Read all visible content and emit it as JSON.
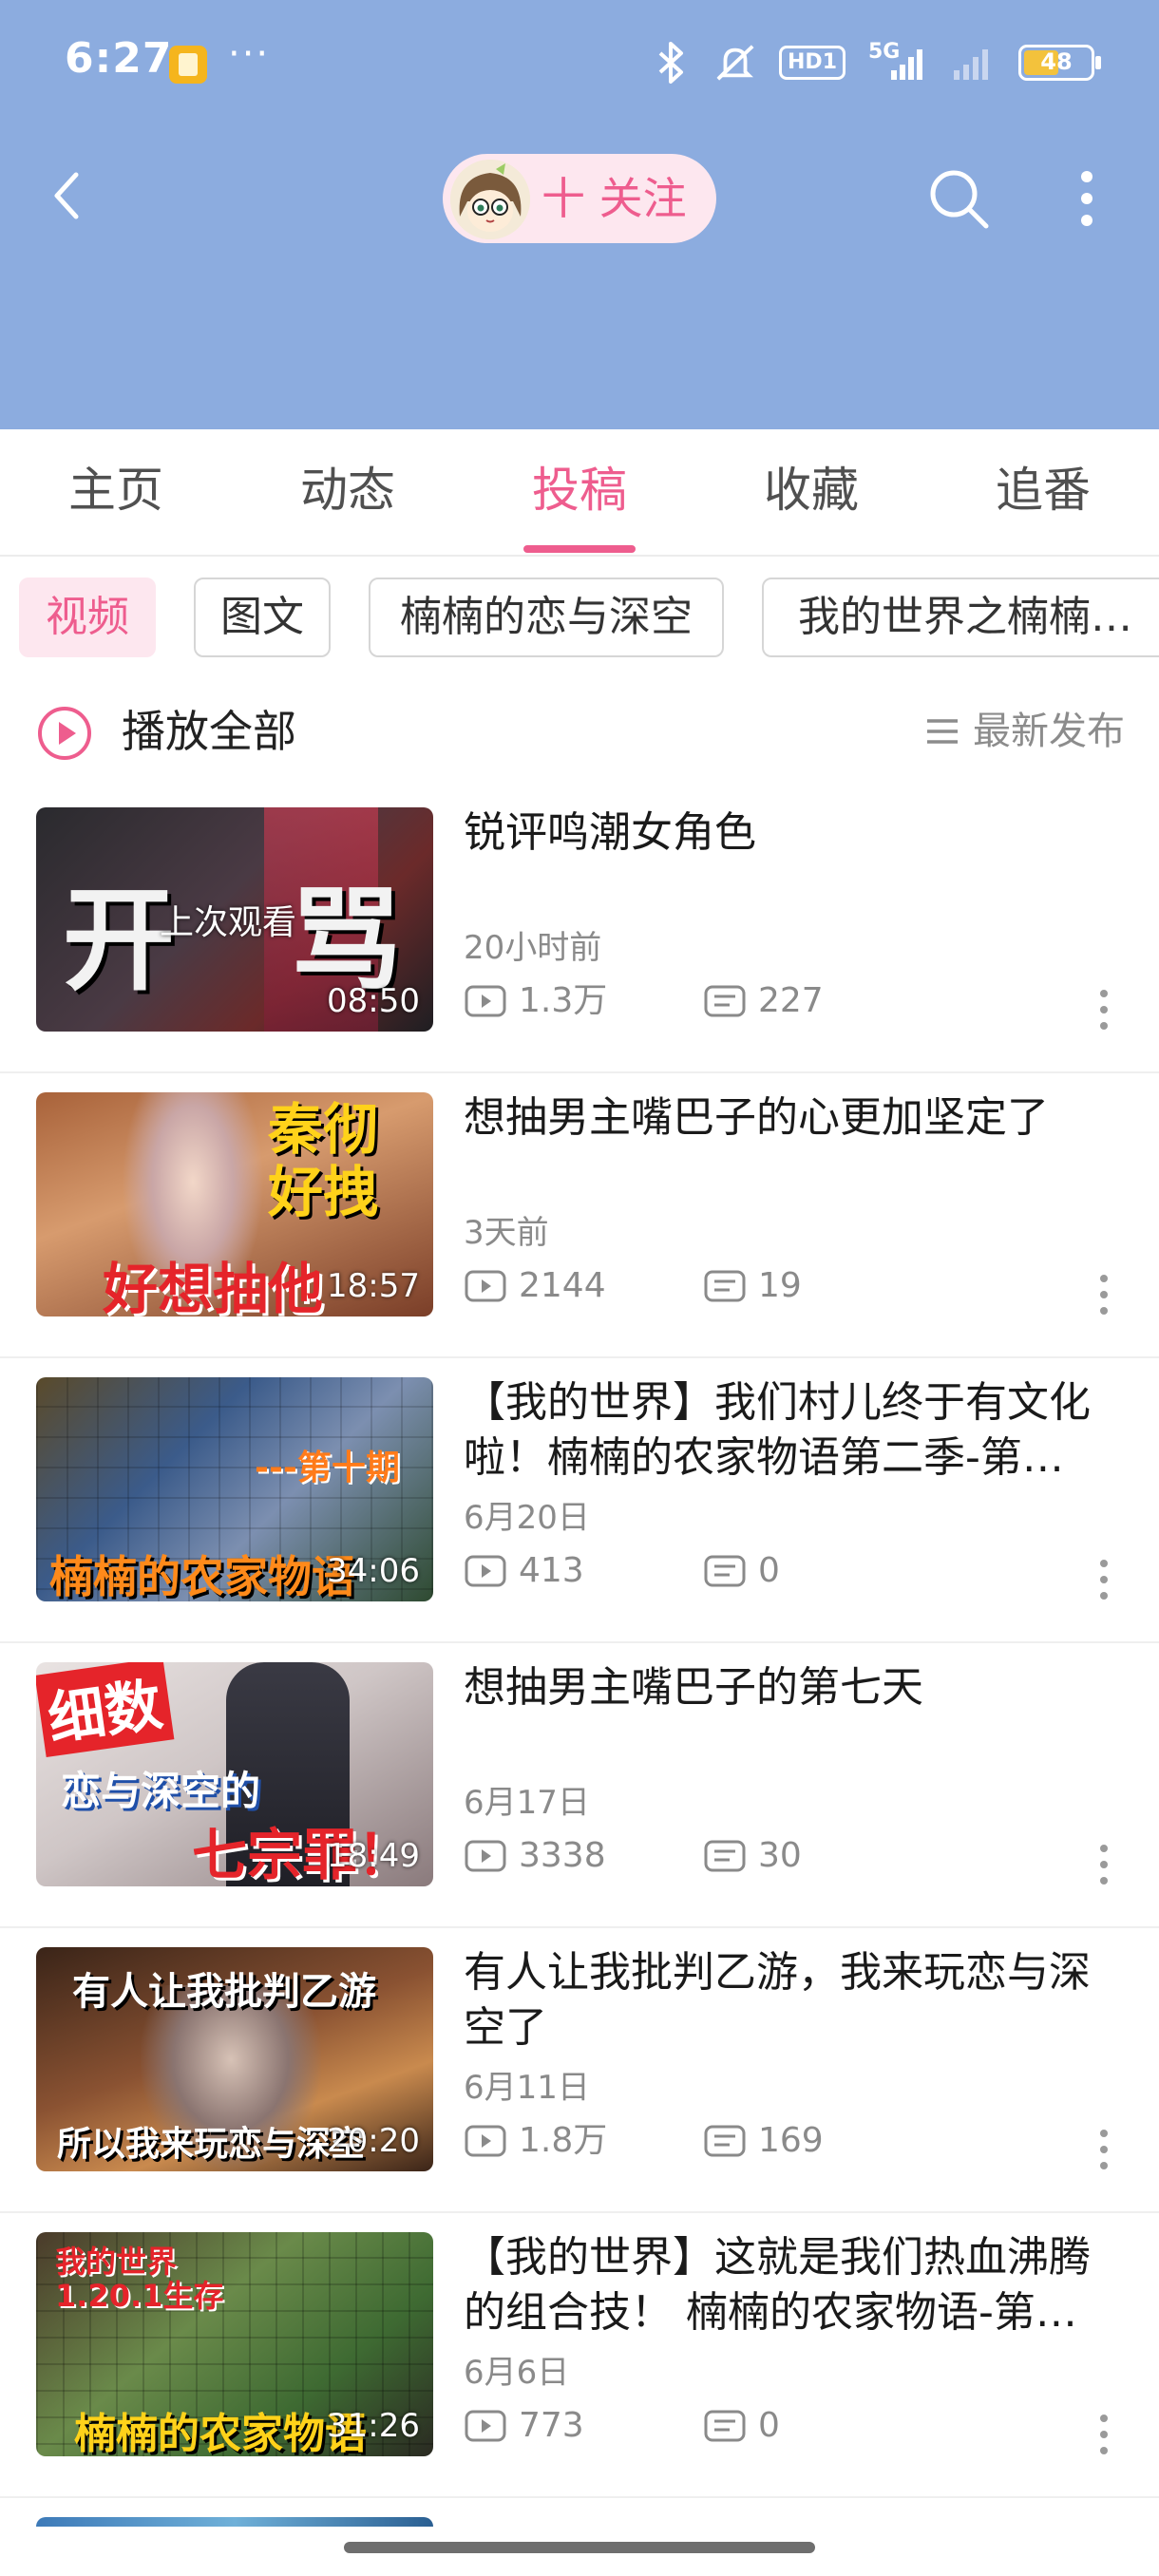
{
  "status_bar": {
    "time": "6:27",
    "more": "···",
    "network": "5G",
    "hd_badge": "HD1",
    "battery_level": "48"
  },
  "header": {
    "follow_label": "十 关注",
    "background_color": "#8cacdf",
    "accent_color": "#ee5d8e"
  },
  "tabs": [
    {
      "label": "主页",
      "active": false
    },
    {
      "label": "动态",
      "active": false
    },
    {
      "label": "投稿",
      "active": true
    },
    {
      "label": "收藏",
      "active": false
    },
    {
      "label": "追番",
      "active": false
    }
  ],
  "chips": [
    {
      "label": "视频",
      "active": true
    },
    {
      "label": "图文",
      "active": false
    },
    {
      "label": "楠楠的恋与深空",
      "active": false
    },
    {
      "label": "我的世界之楠楠…",
      "active": false
    }
  ],
  "play_all": {
    "label": "播放全部",
    "sort_label": "最新发布"
  },
  "videos": [
    {
      "title": "锐评鸣潮女角色",
      "date": "20小时前",
      "views": "1.3万",
      "comments": "227",
      "duration": "08:50",
      "watched_label": "上次观看",
      "thumb_text": "开 骂"
    },
    {
      "title": "想抽男主嘴巴子的心更加坚定了",
      "date": "3天前",
      "views": "2144",
      "comments": "19",
      "duration": "18:57",
      "thumb_text": "秦彻好拽",
      "thumb_text2": "好想抽他"
    },
    {
      "title": "【我的世界】我们村儿终于有文化啦！楠楠的农家物语第二季-第…",
      "date": "6月20日",
      "views": "413",
      "comments": "0",
      "duration": "34:06",
      "thumb_text": "---第十期",
      "thumb_text2": "楠楠的农家物语"
    },
    {
      "title": "想抽男主嘴巴子的第七天",
      "date": "6月17日",
      "views": "3338",
      "comments": "30",
      "duration": "18:49",
      "thumb_text": "细数",
      "thumb_text2": "恋与深空的",
      "thumb_text3": "七宗罪！"
    },
    {
      "title": "有人让我批判乙游，我来玩恋与深空了",
      "date": "6月11日",
      "views": "1.8万",
      "comments": "169",
      "duration": "20:20",
      "thumb_text": "有人让我批判乙游",
      "thumb_text2": "所以我来玩恋与深空"
    },
    {
      "title": "【我的世界】这就是我们热血沸腾的组合技！ 楠楠的农家物语-第…",
      "date": "6月6日",
      "views": "773",
      "comments": "0",
      "duration": "31:26",
      "thumb_text": "我的世界",
      "thumb_text2": "1.20.1生存",
      "thumb_text3": "楠楠的农家物语"
    }
  ]
}
